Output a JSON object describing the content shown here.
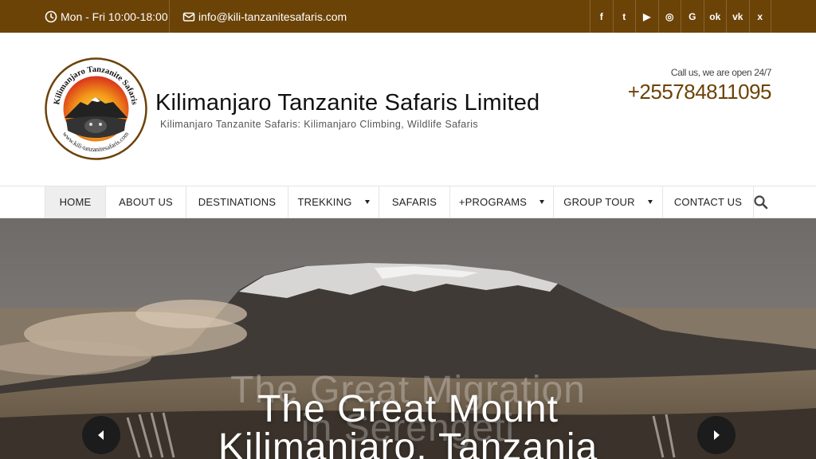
{
  "topbar": {
    "hours": "Mon - Fri 10:00-18:00",
    "email": "info@kili-tanzanitesafaris.com",
    "social": [
      {
        "icon": "facebook-icon",
        "glyph": "f"
      },
      {
        "icon": "twitter-icon",
        "glyph": "t"
      },
      {
        "icon": "youtube-icon",
        "glyph": "▶"
      },
      {
        "icon": "instagram-icon",
        "glyph": "◎"
      },
      {
        "icon": "google-plus-icon",
        "glyph": "G"
      },
      {
        "icon": "odnoklassniki-icon",
        "glyph": "ok"
      },
      {
        "icon": "vk-icon",
        "glyph": "vk"
      },
      {
        "icon": "xing-icon",
        "glyph": "x"
      }
    ]
  },
  "header": {
    "logo_text_top": "Kilimanjaro Tanzanite Safaris",
    "logo_text_bottom": "www.kili-tanzanitesafaris.com",
    "title": "Kilimanjaro Tanzanite Safaris Limited",
    "tagline": "Kilimanjaro Tanzanite Safaris: Kilimanjaro Climbing, Wildlife Safaris",
    "callus": "Call us, we are open 24/7",
    "phone": "+255784811095"
  },
  "nav": {
    "items": [
      {
        "label": "HOME",
        "active": true,
        "dropdown": false
      },
      {
        "label": "ABOUT US",
        "active": false,
        "dropdown": false
      },
      {
        "label": "DESTINATIONS",
        "active": false,
        "dropdown": false
      },
      {
        "label": "TREKKING",
        "active": false,
        "dropdown": true
      },
      {
        "label": "SAFARIS",
        "active": false,
        "dropdown": false
      },
      {
        "label": "+PROGRAMS",
        "active": false,
        "dropdown": true
      },
      {
        "label": "GROUP TOUR",
        "active": false,
        "dropdown": true
      },
      {
        "label": "CONTACT US",
        "active": false,
        "dropdown": false
      }
    ]
  },
  "hero": {
    "ghost_line1": "The Great Migration",
    "ghost_line2": "in Serengeti",
    "caption_line1": "The Great Mount",
    "caption_line2": "Kilimanjaro, Tanzania"
  },
  "colors": {
    "brand": "#6b4307",
    "nav_active": "#eeeeee"
  }
}
